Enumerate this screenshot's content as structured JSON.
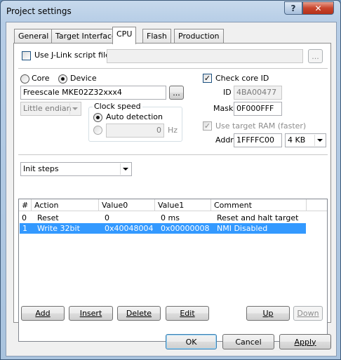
{
  "window": {
    "title": "Project settings",
    "help_glyph": "?",
    "close_glyph": "✕"
  },
  "tabs": [
    "General",
    "Target Interface",
    "CPU",
    "Flash",
    "Production"
  ],
  "active_tab": "CPU",
  "script_file": {
    "label": "Use J-Link script file",
    "checked": false,
    "value": "",
    "browse_label": "..."
  },
  "target": {
    "core_label": "Core",
    "device_label": "Device",
    "selected": "Device",
    "device_value": "Freescale MKE02Z32xxx4",
    "browse_label": "...",
    "endian_value": "Little endian"
  },
  "clock": {
    "group_label": "Clock speed",
    "auto_label": "Auto detection",
    "manual_value": "0",
    "unit": "Hz"
  },
  "core_id": {
    "check_label": "Check core ID",
    "checked": true,
    "id_label": "ID",
    "id_value": "4BA00477",
    "mask_label": "Mask",
    "mask_value": "0F000FFF"
  },
  "ram": {
    "check_label": "Use target RAM (faster)",
    "checked": true,
    "addr_label": "Addr",
    "addr_value": "1FFFFC00",
    "size_value": "4 KB"
  },
  "steps_select": "Init steps",
  "table": {
    "columns": [
      "#",
      "Action",
      "Value0",
      "Value1",
      "Comment"
    ],
    "rows": [
      {
        "num": "0",
        "action": "Reset",
        "v0": "0",
        "v1": "0 ms",
        "comment": "Reset and halt target",
        "selected": false
      },
      {
        "num": "1",
        "action": "Write 32bit",
        "v0": "0x40048004",
        "v1": "0x00000008",
        "comment": "NMI Disabled",
        "selected": true
      }
    ]
  },
  "row_buttons": {
    "add": "Add",
    "insert": "Insert",
    "delete": "Delete",
    "edit": "Edit",
    "up": "Up",
    "down": "Down"
  },
  "dialog_buttons": {
    "ok": "OK",
    "cancel": "Cancel",
    "apply": "Apply"
  },
  "colors": {
    "selection": "#3399ff",
    "titlebar": "#b6cde6",
    "close_button": "#c8452d"
  }
}
